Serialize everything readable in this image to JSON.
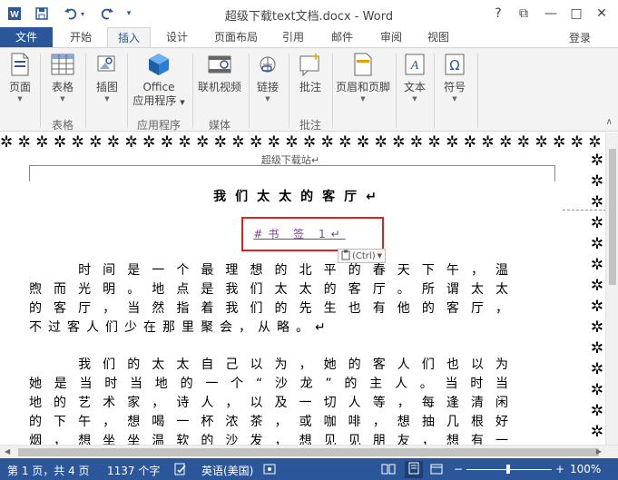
{
  "titlebar": {
    "title": "超级下载text文档.docx - Word",
    "help": "?",
    "restore": "⧉",
    "minimize": "—",
    "maximize": "□",
    "close": "✕"
  },
  "tabs": {
    "file": "文件",
    "home": "开始",
    "insert": "插入",
    "design": "设计",
    "layout": "页面布局",
    "references": "引用",
    "mailings": "邮件",
    "review": "审阅",
    "view": "视图",
    "login": "登录"
  },
  "ribbon": {
    "page": "页面",
    "table": "表格",
    "illustrations": "插图",
    "office_apps_1": "Office",
    "office_apps_2": "应用程序",
    "online_video": "联机视频",
    "link": "链接",
    "comment": "批注",
    "header_footer": "页眉和页脚",
    "text": "文本",
    "symbol": "符号",
    "group_table": "表格",
    "group_apps": "应用程序",
    "group_media": "媒体",
    "group_comments": "批注"
  },
  "document": {
    "header_text": "超级下载站↵",
    "title": "我们太太的客厅↵",
    "bookmark": "#书 签  1↵",
    "paste_label": "(Ctrl)",
    "para1": [
      "　　时间是一个最理想的北平的春天下午，温",
      "煦而光明。地点是我们太太的客厅。所谓太太",
      "的客厅，当然指着我们的先生也有他的客厅，",
      "不过客人们少在那里聚会，从略。↵"
    ],
    "para2": [
      "　　我们的太太自己以为，她的客人们也以为",
      "她是当时当地的一个“沙龙”的主人。当时当",
      "地的艺术家，诗人，以及一切人等，每逢清闲",
      "的下午，想喝一杯浓茶，或咖啡，想抽几根好",
      "烟，想坐坐温软的沙发，想见见朋友，想有一"
    ]
  },
  "statusbar": {
    "page": "第 1 页，共 4 页",
    "words": "1137 个字",
    "language": "英语(美国)",
    "zoom": "100%",
    "zoom_minus": "−",
    "zoom_plus": "+"
  },
  "colors": {
    "accent": "#2b579a",
    "highlight_box": "#e02020",
    "bookmark_text": "#7f3f8f"
  }
}
